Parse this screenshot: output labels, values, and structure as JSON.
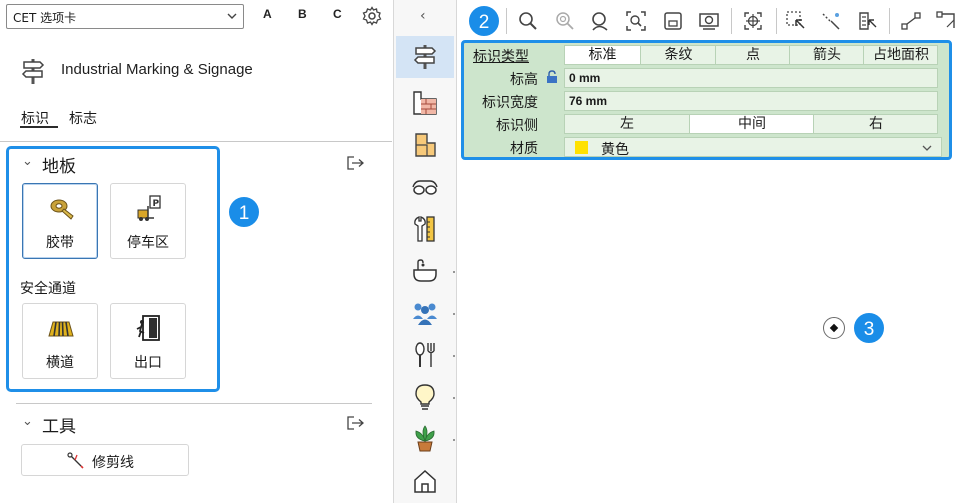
{
  "topbar": {
    "tab_select_value": "CET 选项卡",
    "letters": [
      "A",
      "B",
      "C"
    ]
  },
  "header": {
    "title": "Industrial Marking & Signage",
    "subtabs": [
      "标识",
      "标志"
    ]
  },
  "groups": {
    "floor": {
      "title": "地板",
      "tiles": [
        "胶带",
        "停车区"
      ],
      "section": "安全通道",
      "tiles2": [
        "横道",
        "出口"
      ]
    },
    "tools": {
      "title": "工具",
      "trim_label": "修剪线"
    }
  },
  "badges": [
    "1",
    "2",
    "3"
  ],
  "props": {
    "type_label": "标识类型",
    "type_options": [
      "标准",
      "条纹",
      "点",
      "箭头",
      "占地面积"
    ],
    "type_selected": "标准",
    "height_label": "标高",
    "height_value": "0 mm",
    "width_label": "标识宽度",
    "width_value": "76 mm",
    "side_label": "标识侧",
    "side_options": [
      "左",
      "中间",
      "右"
    ],
    "side_selected": "中间",
    "material_label": "材质",
    "material_value": "黄色",
    "material_color": "#ffe100"
  },
  "colors": {
    "accent": "#1f8fe8",
    "panel_green": "#cde5cc",
    "strip_selected": "#d4e4f5"
  }
}
